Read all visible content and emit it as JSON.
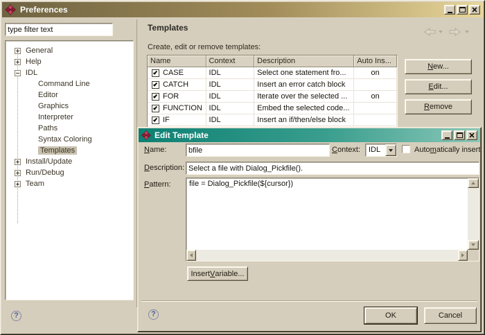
{
  "window": {
    "title": "Preferences",
    "help_glyph": "?"
  },
  "filter": {
    "value": "type filter text"
  },
  "tree": {
    "items": [
      {
        "label": "General",
        "state": "collapsed"
      },
      {
        "label": "Help",
        "state": "collapsed"
      },
      {
        "label": "IDL",
        "state": "expanded",
        "children": [
          "Command Line",
          "Editor",
          "Graphics",
          "Interpreter",
          "Paths",
          "Syntax Coloring",
          "Templates"
        ],
        "selected_child": "Templates"
      },
      {
        "label": "Install/Update",
        "state": "collapsed"
      },
      {
        "label": "Run/Debug",
        "state": "collapsed"
      },
      {
        "label": "Team",
        "state": "collapsed"
      }
    ]
  },
  "templates_panel": {
    "header": "Templates",
    "instruction": "Create, edit or remove templates:",
    "table": {
      "columns": [
        "Name",
        "Context",
        "Description",
        "Auto Ins..."
      ],
      "rows": [
        {
          "checked": true,
          "name": "CASE",
          "context": "IDL",
          "description": "Select one statement fro...",
          "auto_insert": "on"
        },
        {
          "checked": true,
          "name": "CATCH",
          "context": "IDL",
          "description": "Insert an error catch block",
          "auto_insert": ""
        },
        {
          "checked": true,
          "name": "FOR",
          "context": "IDL",
          "description": "Iterate over the selected ...",
          "auto_insert": "on"
        },
        {
          "checked": true,
          "name": "FUNCTION",
          "context": "IDL",
          "description": "Embed the selected code...",
          "auto_insert": ""
        },
        {
          "checked": true,
          "name": "IF",
          "context": "IDL",
          "description": "Insert an if/then/else block",
          "auto_insert": ""
        }
      ]
    },
    "buttons": [
      {
        "t": "New...",
        "u": 0
      },
      {
        "t": "Edit...",
        "u": 0
      },
      {
        "t": "Remove",
        "u": 0
      }
    ]
  },
  "edit_dialog": {
    "title": "Edit Template",
    "help_glyph": "?",
    "name": {
      "label": {
        "t": "Name:",
        "u": 0
      },
      "value": "bfile"
    },
    "context": {
      "label": {
        "t": "Context:",
        "u": 0
      },
      "value": "IDL"
    },
    "auto_insert": {
      "label": {
        "t": "Automatically insert",
        "u": 4
      },
      "checked": false
    },
    "description": {
      "label": {
        "t": "Description:",
        "u": 0
      },
      "value": "Select a file with Dialog_Pickfile()."
    },
    "pattern": {
      "label": {
        "t": "Pattern:",
        "u": 0
      },
      "value": "file = Dialog_Pickfile(${cursor})"
    },
    "insert_variable": {
      "t": "Insert Variable...",
      "u": 7
    },
    "ok": "OK",
    "cancel": "Cancel"
  },
  "colors": {
    "pref_title_start": "#6f6342",
    "pref_title_end": "#e8d79b",
    "dialog_title_start": "#0d8073",
    "dialog_title_end": "#8cc8b9",
    "selection": "#c8c0ad",
    "icon_red_dark": "#8e1b35",
    "icon_red_light": "#c1475a"
  }
}
